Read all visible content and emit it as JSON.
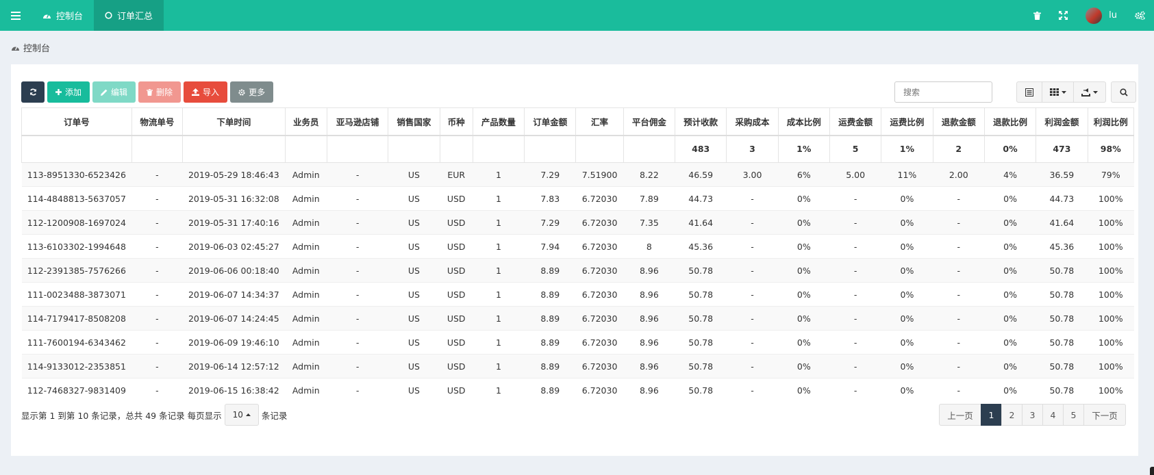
{
  "nav": {
    "tabs": [
      {
        "label": "控制台"
      },
      {
        "label": "订单汇总"
      }
    ],
    "user": "lu"
  },
  "breadcrumb": {
    "label": "控制台"
  },
  "toolbar": {
    "add": "添加",
    "edit": "编辑",
    "delete": "删除",
    "import": "导入",
    "more": "更多"
  },
  "search": {
    "placeholder": "搜索"
  },
  "table": {
    "headers": [
      "订单号",
      "物流单号",
      "下单时间",
      "业务员",
      "亚马逊店铺",
      "销售国家",
      "币种",
      "产品数量",
      "订单金额",
      "汇率",
      "平台佣金",
      "预计收款",
      "采购成本",
      "成本比例",
      "运费金额",
      "运费比例",
      "退款金额",
      "退款比例",
      "利润金额",
      "利润比例"
    ],
    "summary": [
      "",
      "",
      "",
      "",
      "",
      "",
      "",
      "",
      "",
      "",
      "",
      "483",
      "3",
      "1%",
      "5",
      "1%",
      "2",
      "0%",
      "473",
      "98%"
    ],
    "rows": [
      [
        "113-8951330-6523426",
        "-",
        "2019-05-29 18:46:43",
        "Admin",
        "-",
        "US",
        "EUR",
        "1",
        "7.29",
        "7.51900",
        "8.22",
        "46.59",
        "3.00",
        "6%",
        "5.00",
        "11%",
        "2.00",
        "4%",
        "36.59",
        "79%"
      ],
      [
        "114-4848813-5637057",
        "-",
        "2019-05-31 16:32:08",
        "Admin",
        "-",
        "US",
        "USD",
        "1",
        "7.83",
        "6.72030",
        "7.89",
        "44.73",
        "-",
        "0%",
        "-",
        "0%",
        "-",
        "0%",
        "44.73",
        "100%"
      ],
      [
        "112-1200908-1697024",
        "-",
        "2019-05-31 17:40:16",
        "Admin",
        "-",
        "US",
        "USD",
        "1",
        "7.29",
        "6.72030",
        "7.35",
        "41.64",
        "-",
        "0%",
        "-",
        "0%",
        "-",
        "0%",
        "41.64",
        "100%"
      ],
      [
        "113-6103302-1994648",
        "-",
        "2019-06-03 02:45:27",
        "Admin",
        "-",
        "US",
        "USD",
        "1",
        "7.94",
        "6.72030",
        "8",
        "45.36",
        "-",
        "0%",
        "-",
        "0%",
        "-",
        "0%",
        "45.36",
        "100%"
      ],
      [
        "112-2391385-7576266",
        "-",
        "2019-06-06 00:18:40",
        "Admin",
        "-",
        "US",
        "USD",
        "1",
        "8.89",
        "6.72030",
        "8.96",
        "50.78",
        "-",
        "0%",
        "-",
        "0%",
        "-",
        "0%",
        "50.78",
        "100%"
      ],
      [
        "111-0023488-3873071",
        "-",
        "2019-06-07 14:34:37",
        "Admin",
        "-",
        "US",
        "USD",
        "1",
        "8.89",
        "6.72030",
        "8.96",
        "50.78",
        "-",
        "0%",
        "-",
        "0%",
        "-",
        "0%",
        "50.78",
        "100%"
      ],
      [
        "114-7179417-8508208",
        "-",
        "2019-06-07 14:24:45",
        "Admin",
        "-",
        "US",
        "USD",
        "1",
        "8.89",
        "6.72030",
        "8.96",
        "50.78",
        "-",
        "0%",
        "-",
        "0%",
        "-",
        "0%",
        "50.78",
        "100%"
      ],
      [
        "111-7600194-6343462",
        "-",
        "2019-06-09 19:46:10",
        "Admin",
        "-",
        "US",
        "USD",
        "1",
        "8.89",
        "6.72030",
        "8.96",
        "50.78",
        "-",
        "0%",
        "-",
        "0%",
        "-",
        "0%",
        "50.78",
        "100%"
      ],
      [
        "114-9133012-2353851",
        "-",
        "2019-06-14 12:57:12",
        "Admin",
        "-",
        "US",
        "USD",
        "1",
        "8.89",
        "6.72030",
        "8.96",
        "50.78",
        "-",
        "0%",
        "-",
        "0%",
        "-",
        "0%",
        "50.78",
        "100%"
      ],
      [
        "112-7468327-9831409",
        "-",
        "2019-06-15 16:38:42",
        "Admin",
        "-",
        "US",
        "USD",
        "1",
        "8.89",
        "6.72030",
        "8.96",
        "50.78",
        "-",
        "0%",
        "-",
        "0%",
        "-",
        "0%",
        "50.78",
        "100%"
      ]
    ]
  },
  "footer": {
    "info_prefix": "显示第 1 到第 10 条记录，总共 49 条记录 每页显示",
    "page_size": "10",
    "info_suffix": "条记录",
    "prev": "上一页",
    "next": "下一页",
    "pages": [
      "1",
      "2",
      "3",
      "4",
      "5"
    ],
    "current_page": "1"
  },
  "colors": {
    "primary": "#1abc9c",
    "dark": "#2c3e50",
    "danger": "#e74c3c"
  },
  "icons": [
    "menu-icon",
    "dashboard-icon",
    "circle-icon",
    "trash-icon",
    "fullscreen-icon",
    "cogs-icon",
    "refresh-icon",
    "plus-icon",
    "pencil-icon",
    "trash-icon",
    "upload-icon",
    "gear-icon",
    "list-icon",
    "grid-icon",
    "export-icon",
    "search-icon",
    "caret-up-icon"
  ]
}
